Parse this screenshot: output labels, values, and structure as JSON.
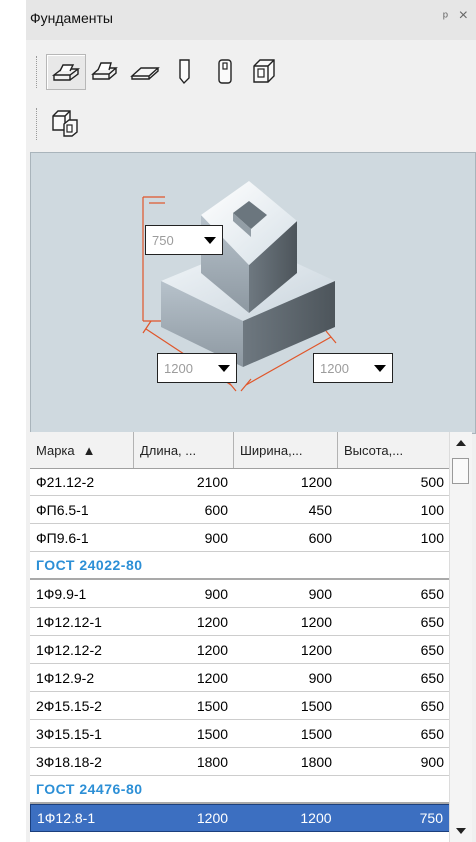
{
  "panel": {
    "title": "Фундаменты",
    "pin_glyph": "ᵖ",
    "close_glyph": "×"
  },
  "toolbar": {
    "tools": [
      {
        "name": "foundation-stepped-icon",
        "selected": true
      },
      {
        "name": "foundation-stepped-alt-icon",
        "selected": false
      },
      {
        "name": "foundation-slab-icon",
        "selected": false
      },
      {
        "name": "pile-icon",
        "selected": false
      },
      {
        "name": "pile-hollow-icon",
        "selected": false
      },
      {
        "name": "foundation-cup-icon",
        "selected": false
      }
    ],
    "tools_row2": [
      {
        "name": "foundation-block-icon",
        "selected": false
      }
    ]
  },
  "preview": {
    "height_value": "750",
    "length_value": "1200",
    "width_value": "1200",
    "dimension_color": "#e0562a"
  },
  "table": {
    "columns": [
      "Марка",
      "Длина, ...",
      "Ширина,...",
      "Высота,..."
    ],
    "sort_indicator": "▲",
    "rows": [
      {
        "type": "row",
        "cells": [
          "Ф21.12-2",
          "2100",
          "1200",
          "500"
        ]
      },
      {
        "type": "row",
        "cells": [
          "ФП6.5-1",
          "600",
          "450",
          "100"
        ]
      },
      {
        "type": "row",
        "cells": [
          "ФП9.6-1",
          "900",
          "600",
          "100"
        ]
      },
      {
        "type": "group",
        "label": "ГОСТ 24022-80"
      },
      {
        "type": "row",
        "cells": [
          "1Ф9.9-1",
          "900",
          "900",
          "650"
        ]
      },
      {
        "type": "row",
        "cells": [
          "1Ф12.12-1",
          "1200",
          "1200",
          "650"
        ]
      },
      {
        "type": "row",
        "cells": [
          "1Ф12.12-2",
          "1200",
          "1200",
          "650"
        ]
      },
      {
        "type": "row",
        "cells": [
          "1Ф12.9-2",
          "1200",
          "900",
          "650"
        ]
      },
      {
        "type": "row",
        "cells": [
          "2Ф15.15-2",
          "1500",
          "1500",
          "650"
        ]
      },
      {
        "type": "row",
        "cells": [
          "3Ф15.15-1",
          "1500",
          "1500",
          "650"
        ]
      },
      {
        "type": "row",
        "cells": [
          "3Ф18.18-2",
          "1800",
          "1800",
          "900"
        ]
      },
      {
        "type": "group",
        "label": "ГОСТ 24476-80"
      },
      {
        "type": "row",
        "cells": [
          "1Ф12.8-1",
          "1200",
          "1200",
          "750"
        ],
        "selected": true
      }
    ]
  },
  "colors": {
    "group_text": "#2c8fd6",
    "selection": "#3c6fc1"
  }
}
